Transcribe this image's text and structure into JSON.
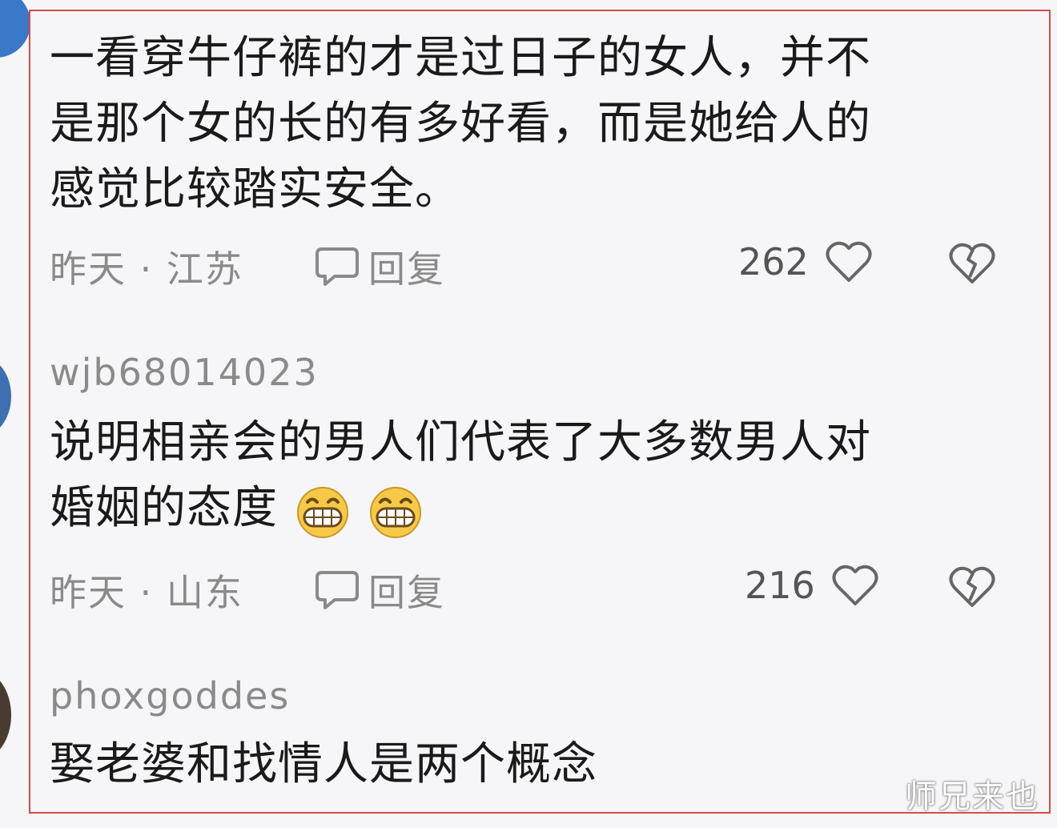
{
  "comments": [
    {
      "text_lines": [
        "一看穿牛仔裤的才是过日子的女人，并不",
        "是那个女的长的有多好看，而是她给人的",
        "感觉比较踏实安全。"
      ],
      "time_location": "昨天 · 江苏",
      "reply_label": "回复",
      "likes": "262"
    },
    {
      "username": "wjb68014023",
      "text_lines": [
        "说明相亲会的男人们代表了大多数男人对",
        "婚姻的态度"
      ],
      "emojis": [
        "grin-emoji",
        "grin-emoji"
      ],
      "time_location": "昨天 · 山东",
      "reply_label": "回复",
      "likes": "216"
    },
    {
      "username": "phoxgoddes",
      "text_lines": [
        "娶老婆和找情人是两个概念"
      ]
    }
  ],
  "watermark": "师兄来也",
  "colors": {
    "frame": "#d84a4a",
    "meta": "#8a8a8a",
    "text": "#1a1a1a"
  }
}
